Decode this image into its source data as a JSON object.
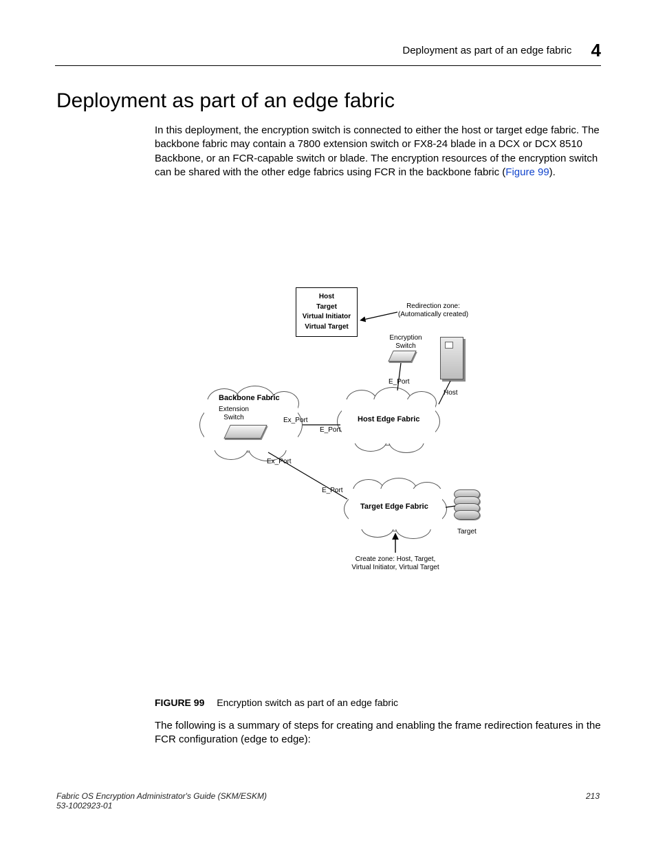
{
  "header": {
    "title": "Deployment as part of an edge fabric",
    "chapter_num": "4"
  },
  "heading": "Deployment as part of an edge fabric",
  "intro": {
    "text": "In this deployment, the encryption switch is connected to either the host or target edge fabric. The backbone fabric may contain a 7800 extension switch or FX8-24 blade in a DCX or DCX 8510 Backbone, or an FCR-capable switch or blade. The encryption resources of the encryption switch can be shared with the other edge fabrics using FCR in the backbone fabric (",
    "link": "Figure 99",
    "tail": ")."
  },
  "diagram": {
    "zone_box": {
      "line1": "Host",
      "line2": "Target",
      "line3": "Virtual Initiator",
      "line4": "Virtual Target"
    },
    "redirection_zone": {
      "line1": "Redirection zone:",
      "line2": "(Automatically created)"
    },
    "encryption_switch": {
      "line1": "Encryption",
      "line2": "Switch"
    },
    "host_label": "Host",
    "backbone_label": "Backbone Fabric",
    "extension_switch": {
      "line1": "Extension",
      "line2": "Switch"
    },
    "host_edge_label": "Host Edge Fabric",
    "target_edge_label": "Target Edge Fabric",
    "target_label": "Target",
    "create_zone": {
      "line1": "Create zone: Host, Target,",
      "line2": "Virtual Initiator, Virtual Target"
    },
    "ports": {
      "eport_top": "E_Port",
      "export1": "Ex_Port",
      "eport_mid": "E_Port",
      "export2": "Ex_Port",
      "eport_bot": "E_Port"
    }
  },
  "figure": {
    "num": "FIGURE 99",
    "caption": "Encryption switch as part of an edge fabric"
  },
  "outro": "The following is a summary of steps for creating and enabling the frame redirection features in the FCR configuration (edge to edge):",
  "footer": {
    "book": "Fabric OS Encryption Administrator's Guide (SKM/ESKM)",
    "docnum": "53-1002923-01",
    "page": "213"
  }
}
